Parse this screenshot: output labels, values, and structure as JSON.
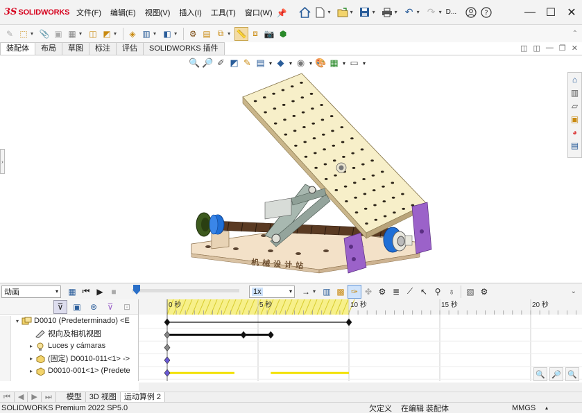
{
  "app": {
    "ds_mark": "3S",
    "brand": "SOLIDWORKS"
  },
  "menu": [
    "文件(F)",
    "编辑(E)",
    "视图(V)",
    "插入(I)",
    "工具(T)",
    "窗口(W)"
  ],
  "quick_access": {
    "truncated_label": "D..."
  },
  "tabs": [
    "装配体",
    "布局",
    "草图",
    "标注",
    "评估",
    "SOLIDWORKS 插件"
  ],
  "active_tab": 0,
  "model": {
    "stamp_text": "机械设计站"
  },
  "motion": {
    "study_type": "动画",
    "speed": "1x",
    "timeline_ticks": [
      "0 秒",
      "5 秒",
      "10 秒",
      "15 秒",
      "20 秒"
    ],
    "tree": [
      {
        "label": "D0010 (Predeterminado) <E",
        "icon": "assembly-icon",
        "expandable": true,
        "expanded": true,
        "indent": 0
      },
      {
        "label": "视向及相机视图",
        "icon": "camera-view-icon",
        "expandable": false,
        "indent": 1
      },
      {
        "label": "Luces y cámaras",
        "icon": "lights-cameras-icon",
        "expandable": true,
        "expanded": false,
        "indent": 1
      },
      {
        "label": "(固定) D0010-011<1> ->",
        "icon": "part-icon",
        "expandable": true,
        "expanded": false,
        "indent": 1
      },
      {
        "label": "D0010-001<1> (Predete",
        "icon": "part-icon",
        "expandable": true,
        "expanded": false,
        "indent": 1
      }
    ],
    "tracks": [
      {
        "row": 0,
        "type": "line",
        "start": 0,
        "end": 10,
        "keys": [
          0,
          10
        ]
      },
      {
        "row": 1,
        "type": "thick",
        "start": 0,
        "end": 5.7,
        "keys": [
          0,
          4.2,
          5.7
        ]
      },
      {
        "row": 2,
        "type": "key",
        "keys": [
          0
        ]
      },
      {
        "row": 3,
        "type": "key",
        "keys": [
          0
        ]
      },
      {
        "row": 4,
        "type": "segments",
        "segments": [
          [
            0,
            3.7
          ],
          [
            5.7,
            10
          ]
        ],
        "keys": [
          0
        ]
      }
    ],
    "time_max_visible": 22.5
  },
  "bottom_tabs": [
    "模型",
    "3D 视图",
    "运动算例 2"
  ],
  "active_bottom_tab": 2,
  "status": {
    "version": "SOLIDWORKS Premium 2022 SP5.0",
    "state": "欠定义",
    "mode": "在编辑 装配体",
    "units": "MMGS"
  },
  "colors": {
    "plate": "#f7efc9",
    "plate_edge": "#c9b58a",
    "base": "#f3e1c8",
    "purple": "#9b62c9",
    "blue_nut": "#1f6fd6",
    "screw": "#5a3a22",
    "track_yellow": "#f2e100",
    "brand_red": "#d6001c"
  }
}
